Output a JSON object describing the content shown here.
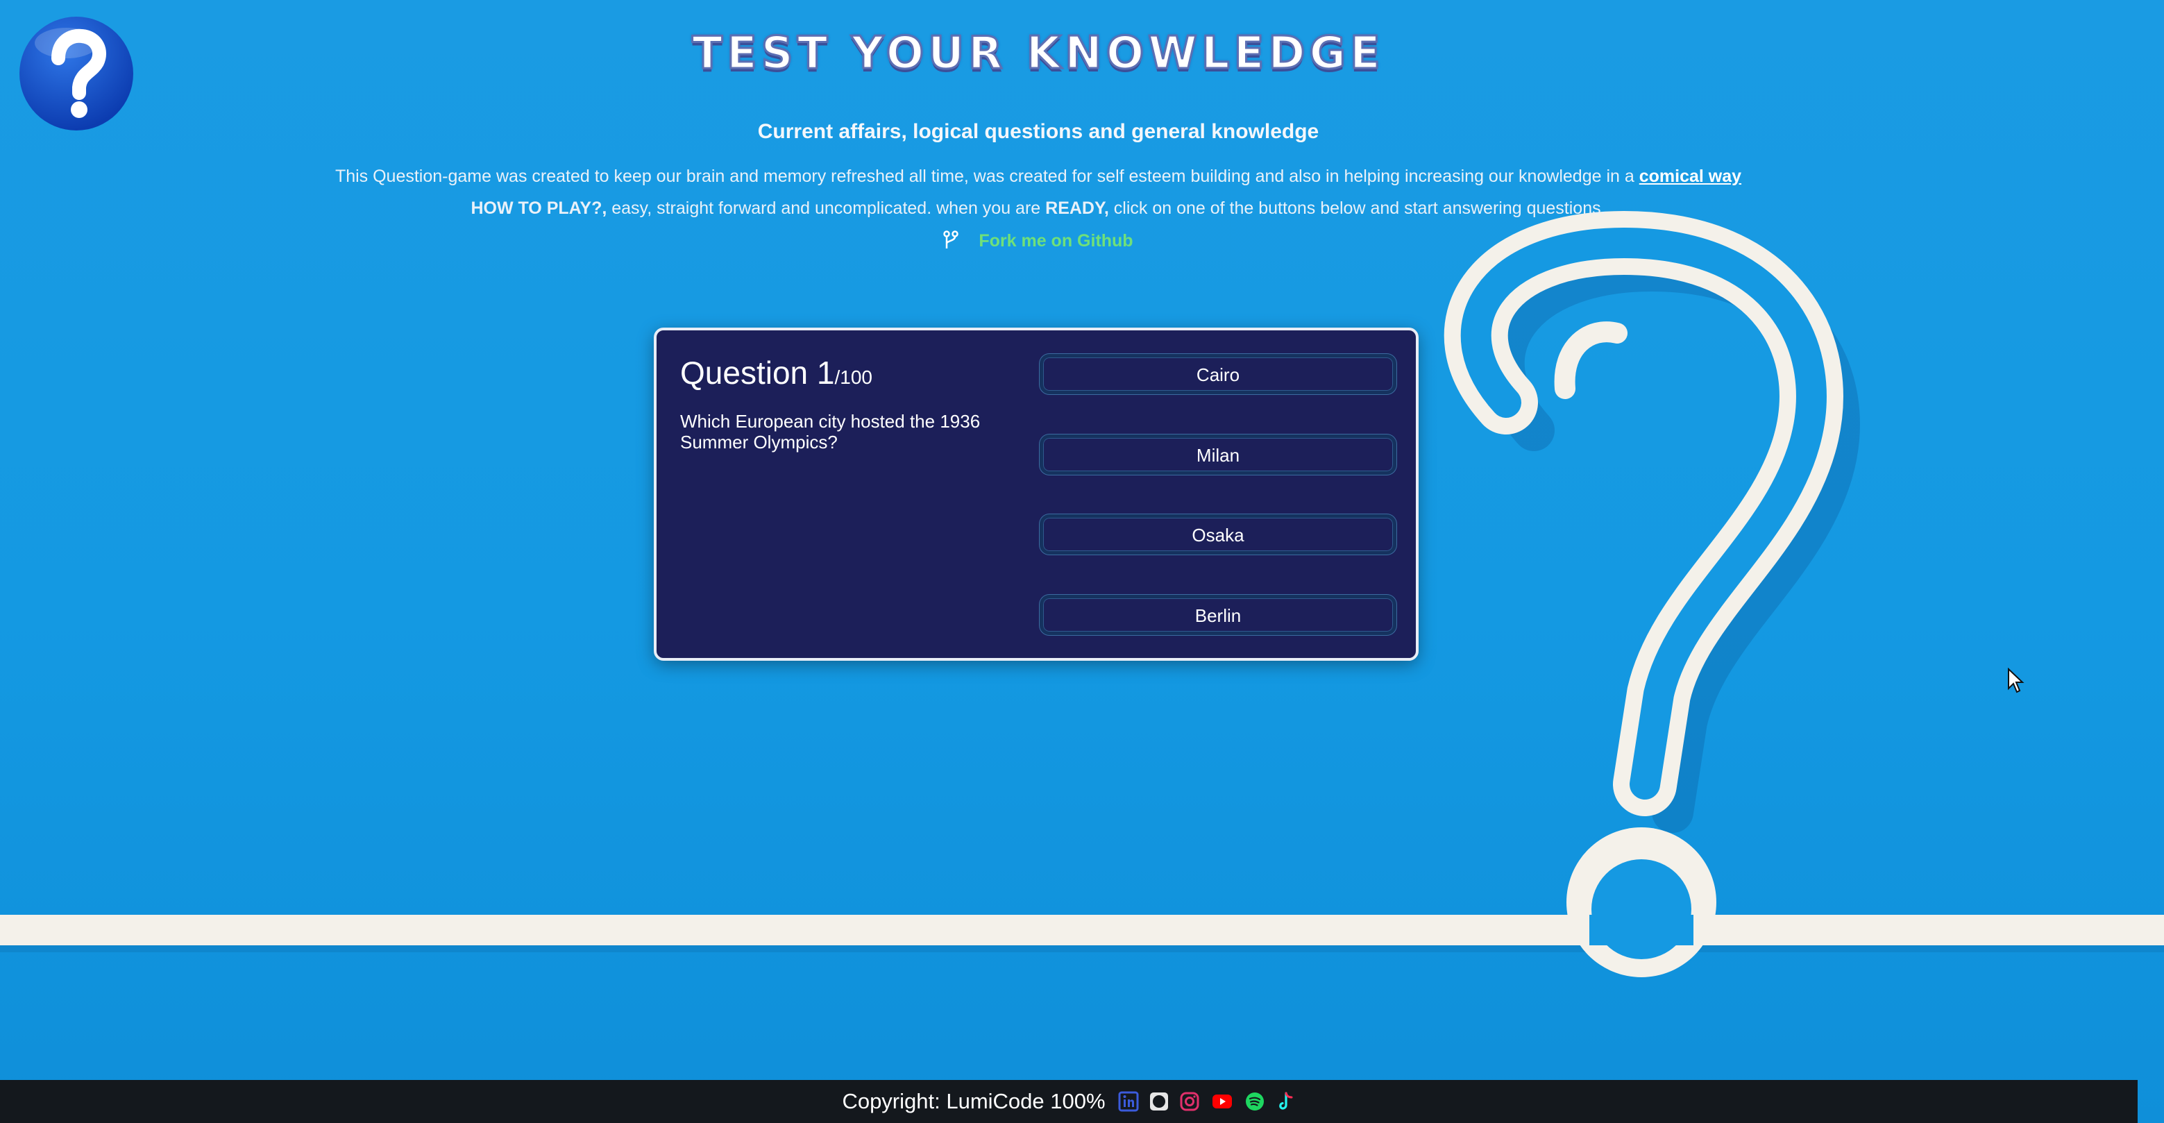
{
  "header": {
    "title": "TEST YOUR KNOWLEDGE",
    "subtitle": "Current affairs, logical questions and general knowledge",
    "intro_text": "This Question-game was created to keep our brain and memory refreshed all time, was created for self esteem building and also in helping increasing our knowledge in a",
    "intro_link": "comical way",
    "howto_bold": "HOW TO PLAY?,",
    "howto_text_1": "easy, straight forward and uncomplicated. when you are",
    "ready_bold": "READY,",
    "howto_text_2": "click on one of the buttons below and start answering questions.",
    "github_link": "Fork me on Github"
  },
  "quiz": {
    "question_label": "Question 1",
    "question_count": "/100",
    "question_text": "Which European city hosted the 1936 Summer Olympics?",
    "answers": [
      "Cairo",
      "Milan",
      "Osaka",
      "Berlin"
    ]
  },
  "footer": {
    "copyright": "Copyright: LumiCode 100%",
    "social_icons": [
      "linkedin-icon",
      "github-icon",
      "instagram-icon",
      "youtube-icon",
      "spotify-icon",
      "tiktok-icon"
    ]
  },
  "colors": {
    "background": "#1499e2",
    "card": "#1c1f59",
    "link_green": "#6fe07a",
    "footer": "#14181d"
  }
}
